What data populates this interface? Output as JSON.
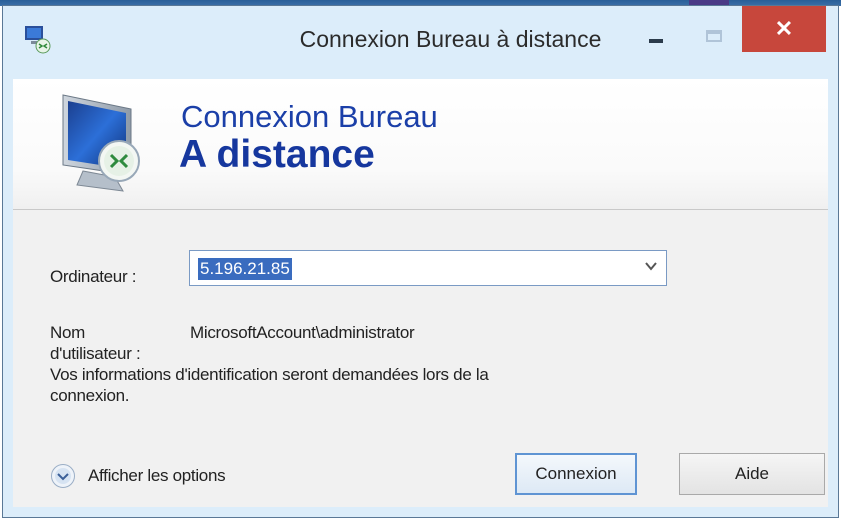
{
  "window": {
    "title": "Connexion Bureau à distance",
    "close_glyph": "✕"
  },
  "banner": {
    "line1": "Connexion Bureau",
    "line2": "A distance"
  },
  "form": {
    "computer_label": "Ordinateur :",
    "computer_value": "5.196.21.85",
    "username_label_line1": "Nom",
    "username_label_line2": "d'utilisateur :",
    "username_value": "MicrosoftAccount\\administrator",
    "info_line1": "Vos informations d'identification seront demandées lors de la",
    "info_line2": "connexion."
  },
  "footer": {
    "options_label": "Afficher les options",
    "connect_label": "Connexion",
    "help_label": "Aide"
  },
  "icons": {
    "app": "remote-desktop-icon",
    "banner": "monitor-icon",
    "options": "expand-options-icon",
    "combo": "chevron-down-icon"
  },
  "colors": {
    "titlebar": "#dcedfa",
    "close_button": "#c7473c",
    "banner_text": "#1b3fa8",
    "selection": "#3a6cbf",
    "default_button_border": "#5f94d3"
  }
}
